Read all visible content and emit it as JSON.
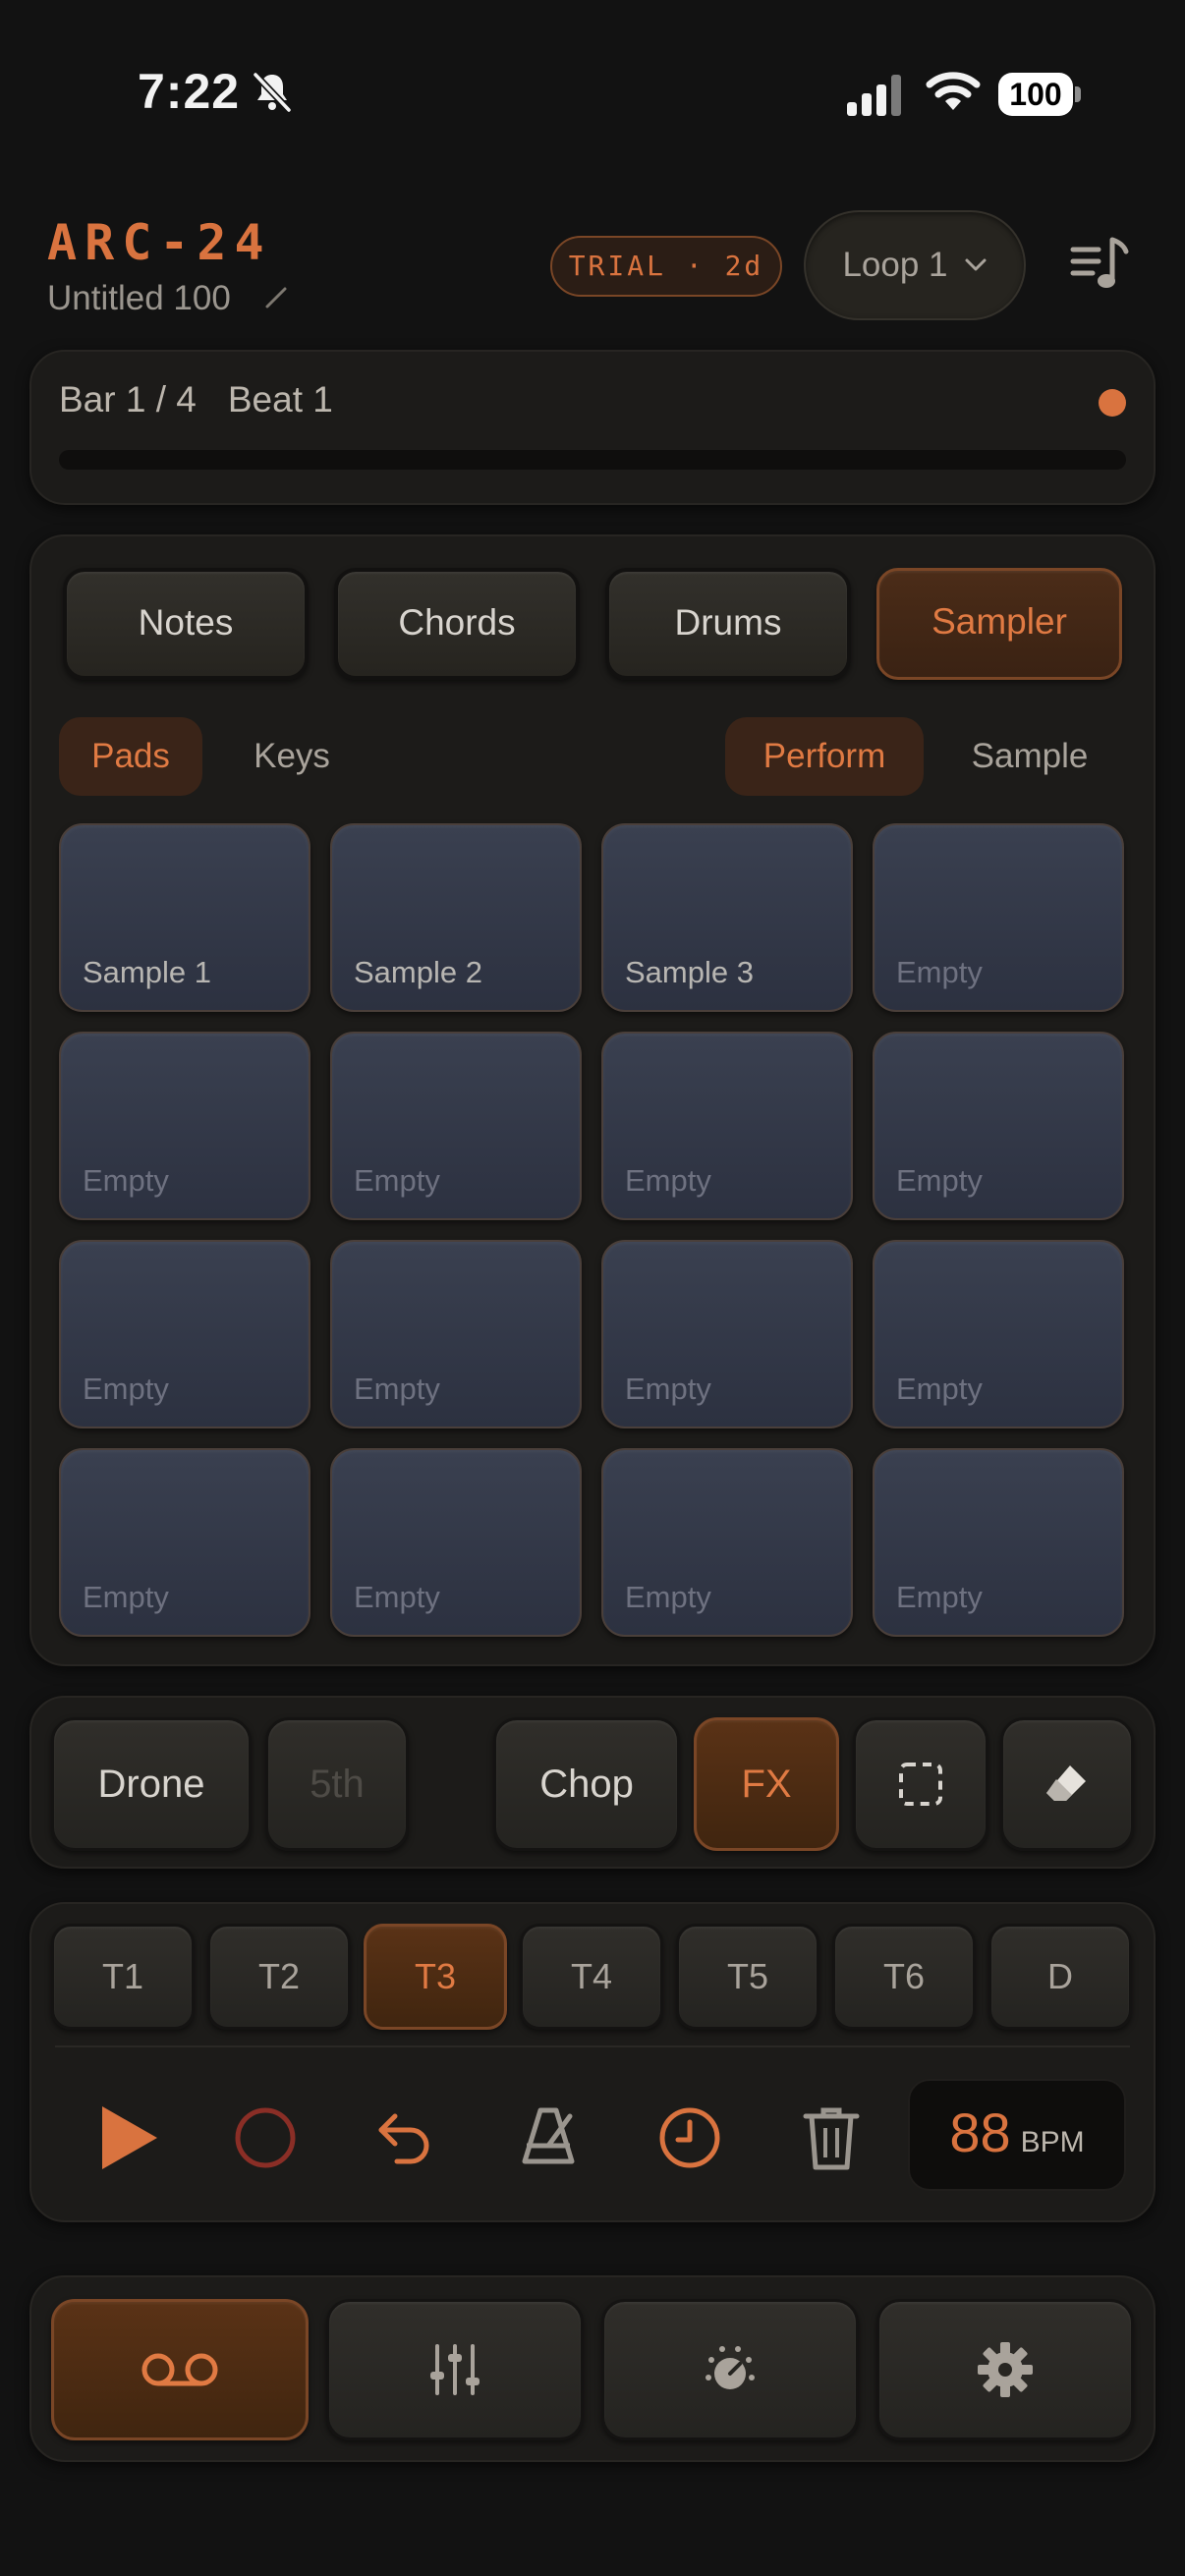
{
  "status_bar": {
    "time": "7:22",
    "battery": "100"
  },
  "header": {
    "app_title": "ARC-24",
    "project_name": "Untitled 100",
    "trial_badge": "TRIAL · 2d",
    "loop_select": "Loop 1"
  },
  "position": {
    "bar": "Bar 1 / 4",
    "beat": "Beat 1",
    "progress": 0.0
  },
  "modes": [
    "Notes",
    "Chords",
    "Drums",
    "Sampler"
  ],
  "active_mode": "Sampler",
  "view_toggle": {
    "left": [
      "Pads",
      "Keys"
    ],
    "right": [
      "Perform",
      "Sample"
    ],
    "active_left": "Pads",
    "active_right": "Perform"
  },
  "pads": [
    "Sample 1",
    "Sample 2",
    "Sample 3",
    "Empty",
    "Empty",
    "Empty",
    "Empty",
    "Empty",
    "Empty",
    "Empty",
    "Empty",
    "Empty",
    "Empty",
    "Empty",
    "Empty",
    "Empty"
  ],
  "tools": {
    "drone": "Drone",
    "fifth": "5th",
    "chop": "Chop",
    "fx": "FX"
  },
  "tracks": [
    "T1",
    "T2",
    "T3",
    "T4",
    "T5",
    "T6",
    "D"
  ],
  "active_track": "T3",
  "tempo": {
    "bpm": "88",
    "unit": "BPM"
  },
  "colors": {
    "accent": "#d9733f",
    "background": "#121212",
    "pad": "#333849"
  },
  "icons": {
    "transport": [
      "play-icon",
      "record-icon",
      "undo-icon",
      "metronome-icon",
      "count-in-clock-icon",
      "trash-icon"
    ],
    "tools": [
      "selection-icon",
      "eraser-icon"
    ],
    "nav": [
      "tape-recorder-icon",
      "mixer-sliders-icon",
      "knob-icon",
      "settings-gear-icon"
    ]
  }
}
